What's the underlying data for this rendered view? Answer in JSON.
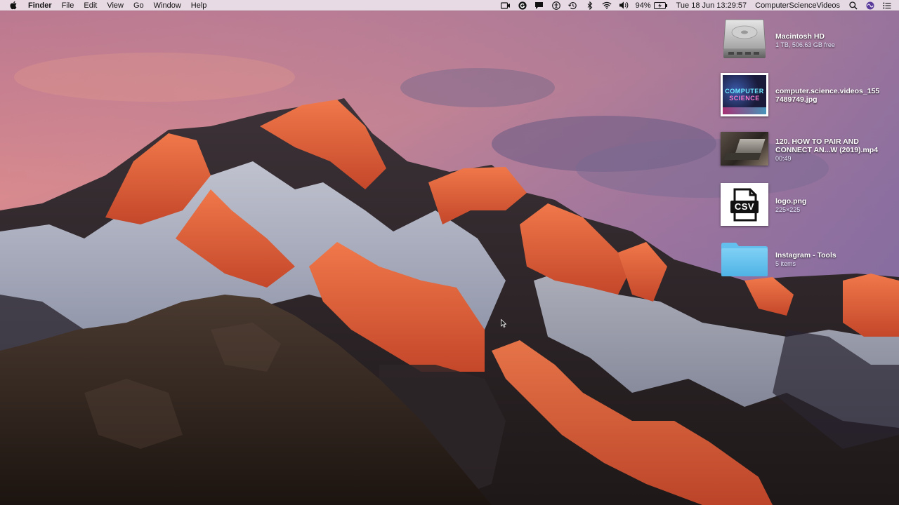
{
  "menubar": {
    "app_name": "Finder",
    "menus": [
      "File",
      "Edit",
      "View",
      "Go",
      "Window",
      "Help"
    ],
    "battery": "94%",
    "clock": "Tue 18 Jun  13:29:57",
    "user": "ComputerScienceVideos"
  },
  "desktop": {
    "items": [
      {
        "name": "Macintosh HD",
        "meta": "1 TB, 506.63 GB free",
        "kind": "hard-drive"
      },
      {
        "name_line1": "computer.science.videos_155",
        "name_line2": "7489749.jpg",
        "kind": "image-thumbnail",
        "thumb_line1": "COMPUTER",
        "thumb_line2": "SCIENCE"
      },
      {
        "name_line1": "120. HOW TO PAIR AND",
        "name_line2": "CONNECT AN...W (2019).mp4",
        "meta": "00:49",
        "kind": "video-thumbnail"
      },
      {
        "name": "logo.png",
        "meta": "225×225",
        "kind": "csv-logo",
        "thumb_text": "CSV"
      },
      {
        "name": "Instagram - Tools",
        "meta": "5 items",
        "kind": "folder"
      }
    ]
  },
  "colors": {
    "sky_top": "#c97a8e",
    "sky_mid": "#9a6e9a",
    "folder_blue": "#5cbcea",
    "alpenglow": "#e2643a"
  }
}
